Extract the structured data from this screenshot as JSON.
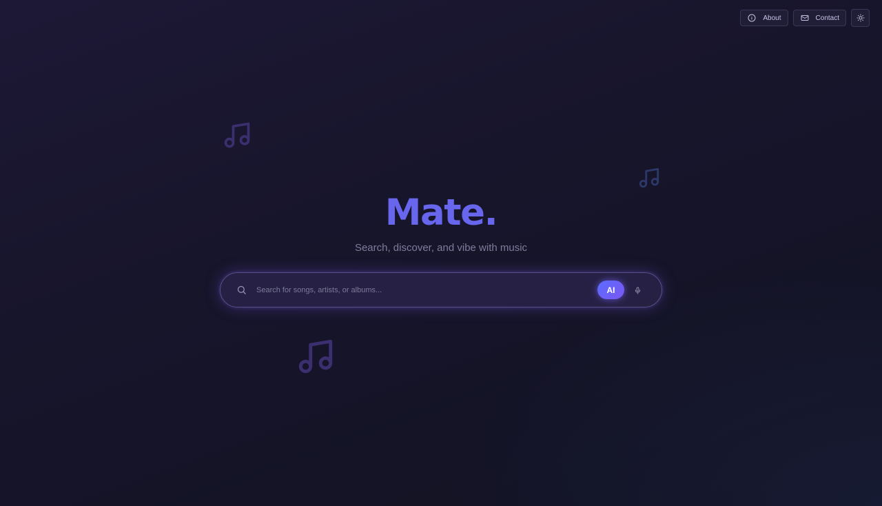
{
  "nav": {
    "about_label": "About",
    "contact_label": "Contact",
    "about_icon": "info-icon",
    "contact_icon": "mail-icon",
    "theme_icon": "sun-icon"
  },
  "hero": {
    "title": "Mate.",
    "subtitle": "Search, discover, and vibe with music"
  },
  "search": {
    "placeholder": "Search for songs, artists, or albums...",
    "value": "",
    "ai_label": "AI",
    "search_icon": "search-icon",
    "mic_icon": "mic-icon"
  },
  "decorations": {
    "icon": "music-note-icon"
  },
  "colors": {
    "accent": "#6766ec",
    "background": "#17152b",
    "ai_gradient_start": "#5b6cff",
    "ai_gradient_end": "#7a58f2"
  }
}
